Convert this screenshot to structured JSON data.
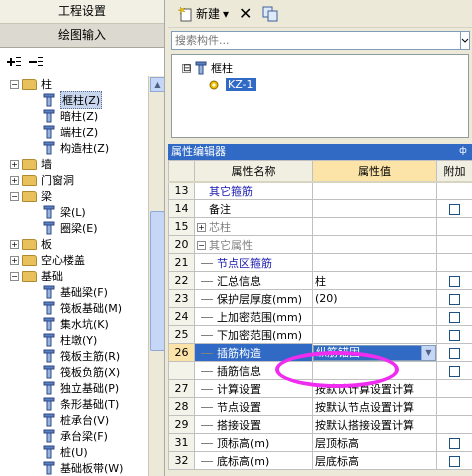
{
  "left_panel": {
    "header1": "工程设置",
    "header2": "绘图输入",
    "tree": [
      {
        "label": "柱",
        "level": 0,
        "type": "folder",
        "expanded": true
      },
      {
        "label": "框柱(Z)",
        "level": 1,
        "type": "item",
        "selected": true
      },
      {
        "label": "暗柱(Z)",
        "level": 1,
        "type": "item"
      },
      {
        "label": "端柱(Z)",
        "level": 1,
        "type": "item"
      },
      {
        "label": "构造柱(Z)",
        "level": 1,
        "type": "item"
      },
      {
        "label": "墙",
        "level": 0,
        "type": "folder",
        "expanded": false
      },
      {
        "label": "门窗洞",
        "level": 0,
        "type": "folder",
        "expanded": false
      },
      {
        "label": "梁",
        "level": 0,
        "type": "folder",
        "expanded": true
      },
      {
        "label": "梁(L)",
        "level": 1,
        "type": "item"
      },
      {
        "label": "圈梁(E)",
        "level": 1,
        "type": "item"
      },
      {
        "label": "板",
        "level": 0,
        "type": "folder",
        "expanded": false
      },
      {
        "label": "空心楼盖",
        "level": 0,
        "type": "folder",
        "expanded": false
      },
      {
        "label": "基础",
        "level": 0,
        "type": "folder",
        "expanded": true
      },
      {
        "label": "基础梁(F)",
        "level": 1,
        "type": "item"
      },
      {
        "label": "筏板基础(M)",
        "level": 1,
        "type": "item"
      },
      {
        "label": "集水坑(K)",
        "level": 1,
        "type": "item"
      },
      {
        "label": "柱墩(Y)",
        "level": 1,
        "type": "item"
      },
      {
        "label": "筏板主筋(R)",
        "level": 1,
        "type": "item"
      },
      {
        "label": "筏板负筋(X)",
        "level": 1,
        "type": "item"
      },
      {
        "label": "独立基础(P)",
        "level": 1,
        "type": "item"
      },
      {
        "label": "条形基础(T)",
        "level": 1,
        "type": "item"
      },
      {
        "label": "桩承台(V)",
        "level": 1,
        "type": "item"
      },
      {
        "label": "承台梁(F)",
        "level": 1,
        "type": "item"
      },
      {
        "label": "桩(U)",
        "level": 1,
        "type": "item"
      },
      {
        "label": "基础板带(W)",
        "level": 1,
        "type": "item"
      }
    ]
  },
  "toolbar": {
    "new_label": "新建",
    "dropdown_arrow": "▾",
    "delete_symbol": "✕"
  },
  "search": {
    "placeholder": "搜索构件..."
  },
  "component_tree": {
    "root": "框柱",
    "child": "KZ-1",
    "expander": "⊟"
  },
  "property_editor": {
    "title": "属性编辑器",
    "pin_symbol": "ф",
    "columns": {
      "name": "属性名称",
      "value": "属性值",
      "extra": "附加"
    },
    "rows": [
      {
        "num": "13",
        "name": "其它箍筋",
        "value": "",
        "style": "blue",
        "checkbox": false,
        "indent": "none"
      },
      {
        "num": "14",
        "name": "备注",
        "value": "",
        "style": "normal",
        "checkbox": true,
        "indent": "none"
      },
      {
        "num": "15",
        "name": "芯柱",
        "value": "",
        "style": "gray",
        "checkbox": false,
        "indent": "group",
        "expander": "+"
      },
      {
        "num": "20",
        "name": "其它属性",
        "value": "",
        "style": "gray",
        "checkbox": false,
        "indent": "group",
        "expander": "−"
      },
      {
        "num": "21",
        "name": "节点区箍筋",
        "value": "",
        "style": "blue",
        "checkbox": false,
        "indent": "child"
      },
      {
        "num": "22",
        "name": "汇总信息",
        "value": "柱",
        "style": "normal",
        "checkbox": true,
        "indent": "child"
      },
      {
        "num": "23",
        "name": "保护层厚度(mm)",
        "value": "(20)",
        "style": "normal",
        "checkbox": true,
        "indent": "child"
      },
      {
        "num": "24",
        "name": "上加密范围(mm)",
        "value": "",
        "style": "normal",
        "checkbox": true,
        "indent": "child"
      },
      {
        "num": "25",
        "name": "下加密范围(mm)",
        "value": "",
        "style": "normal",
        "checkbox": true,
        "indent": "child"
      },
      {
        "num": "26",
        "name": "插筋构造",
        "value": "纵筋锚固",
        "style": "active",
        "checkbox": true,
        "indent": "child"
      },
      {
        "num": "",
        "name": "插筋信息",
        "value": "",
        "style": "normal",
        "checkbox": true,
        "indent": "child"
      },
      {
        "num": "27",
        "name": "计算设置",
        "value": "按默认计算设置计算",
        "style": "normal",
        "checkbox": false,
        "indent": "child"
      },
      {
        "num": "28",
        "name": "节点设置",
        "value": "按默认节点设置计算",
        "style": "normal",
        "checkbox": false,
        "indent": "child"
      },
      {
        "num": "29",
        "name": "搭接设置",
        "value": "按默认搭接设置计算",
        "style": "normal",
        "checkbox": false,
        "indent": "child"
      },
      {
        "num": "31",
        "name": "顶标高(m)",
        "value": "层顶标高",
        "style": "normal",
        "checkbox": true,
        "indent": "child"
      },
      {
        "num": "32",
        "name": "底标高(m)",
        "value": "层底标高",
        "style": "normal",
        "checkbox": true,
        "indent": "child"
      }
    ]
  },
  "colors": {
    "selection_blue": "#316ac5",
    "header_yellow": "#fce4a8",
    "annotation_magenta": "#ef2cf0",
    "link_blue": "#1a1ab0"
  }
}
